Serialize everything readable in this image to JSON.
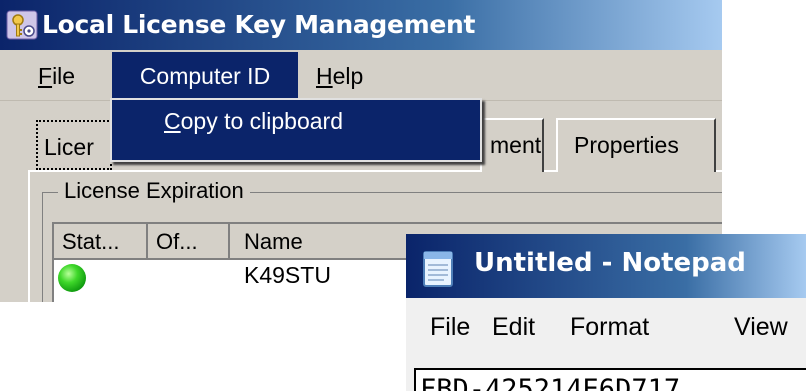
{
  "license_manager": {
    "title": "Local License Key Management",
    "menu": {
      "file": "File",
      "computer_id": "Computer ID",
      "help": "Help"
    },
    "dropdown": {
      "items": [
        "Copy to clipboard"
      ]
    },
    "tabs": [
      "Licer",
      "ment",
      "Properties"
    ],
    "group_title": "License Expiration",
    "columns": [
      "Stat...",
      "Of...",
      "Name"
    ],
    "rows": [
      {
        "status": "active",
        "name": "K49STU"
      }
    ]
  },
  "notepad": {
    "title": "Untitled - Notepad",
    "menu": [
      "File",
      "Edit",
      "Format",
      "View"
    ],
    "text": "FBD-425214E6D717"
  },
  "colors": {
    "titlebar_active": "#0b246a",
    "menu_highlight": "#0b246a",
    "window_face": "#d4d0c8",
    "status_green": "#3fd82a"
  }
}
